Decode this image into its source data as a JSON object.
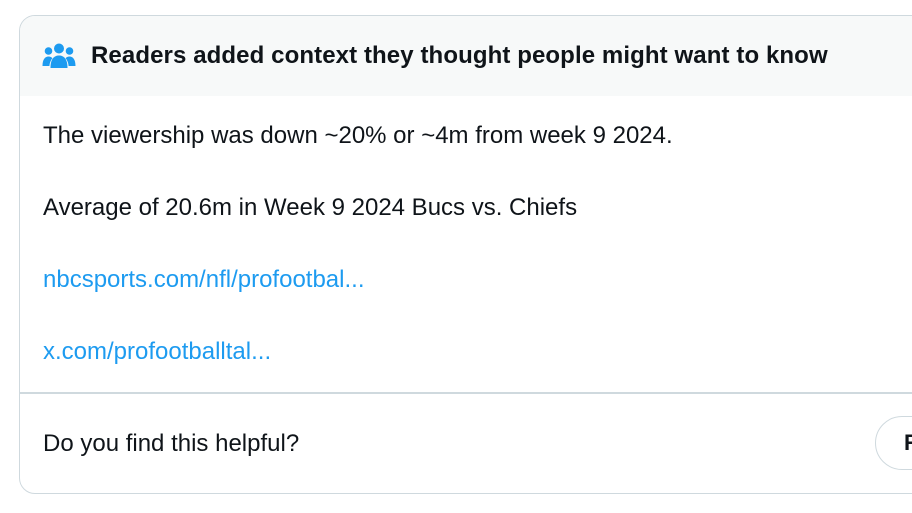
{
  "note": {
    "header_title": "Readers added context they thought people might want to know",
    "header_icon": "people-icon",
    "body_line_1": "The viewership was down ~20% or ~4m from week 9 2024.",
    "body_line_2": "Average of 20.6m in Week 9 2024 Bucs vs. Chiefs",
    "links": [
      "nbcsports.com/nfl/profootbal...",
      "x.com/profootballtal..."
    ],
    "footer_question": "Do you find this helpful?",
    "rate_button_label": "R"
  },
  "colors": {
    "text": "#0f1419",
    "link": "#1d9bf0",
    "icon": "#1d9bf0",
    "header_bg": "#f7f9f9",
    "border": "#cfd9de"
  }
}
